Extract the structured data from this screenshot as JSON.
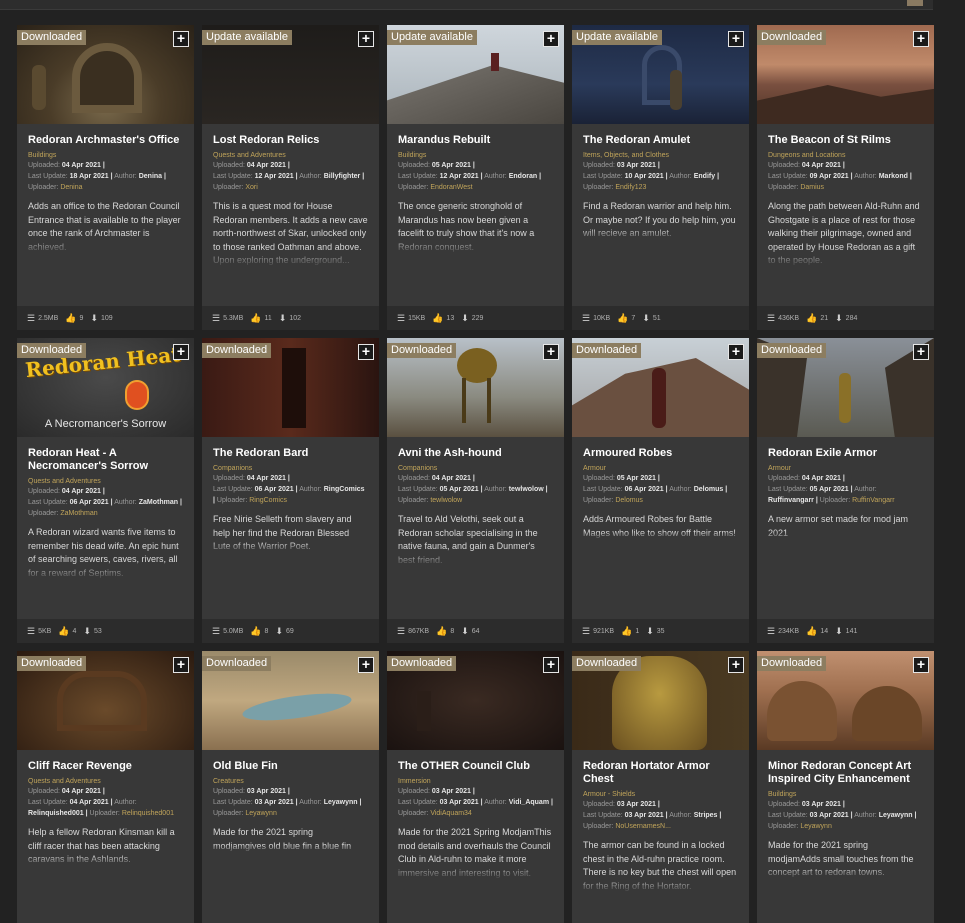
{
  "mods": [
    {
      "badge": "Downloaded",
      "title": "Redoran Archmaster's Office",
      "category": "Buildings",
      "uploaded": "04 Apr 2021",
      "last_update": "18 Apr 2021",
      "author": "Denina",
      "uploader": "Denina",
      "description": "Adds an office to the Redoran Council Entrance that is available to the player once the rank of Archmaster is achieved.",
      "size": "2.5MB",
      "endorsements": "9",
      "downloads": "109",
      "scene": "arch"
    },
    {
      "badge": "Update available",
      "title": "Lost Redoran Relics",
      "category": "Quests and Adventures",
      "uploaded": "04 Apr 2021",
      "last_update": "12 Apr 2021",
      "author": "Billyfighter",
      "uploader": "Xori",
      "description": "This is a quest mod for House Redoran members. It adds a new cave north-northwest of Skar, unlocked only to those ranked Oathman and above. Upon exploring the underground...",
      "size": "5.3MB",
      "endorsements": "11",
      "downloads": "102",
      "scene": "dark"
    },
    {
      "badge": "Update available",
      "title": "Marandus Rebuilt",
      "category": "Buildings",
      "uploaded": "05 Apr 2021",
      "last_update": "12 Apr 2021",
      "author": "Endoran",
      "uploader": "EndoranWest",
      "description": "The once generic stronghold of Marandus has now been given a facelift to truly show that it's now a Redoran conquest.",
      "size": "15KB",
      "endorsements": "13",
      "downloads": "229",
      "scene": "stairs"
    },
    {
      "badge": "Update available",
      "title": "The Redoran Amulet",
      "category": "Items, Objects, and Clothes",
      "uploaded": "03 Apr 2021",
      "last_update": "10 Apr 2021",
      "author": "Endify",
      "uploader": "Endify123",
      "description": "Find a Redoran warrior and help him. Or maybe not? If you do help him, you will recieve an amulet.",
      "size": "10KB",
      "endorsements": "7",
      "downloads": "51",
      "scene": "blue"
    },
    {
      "badge": "Downloaded",
      "title": "The Beacon of St Rilms",
      "category": "Dungeons and Locations",
      "uploaded": "04 Apr 2021",
      "last_update": "09 Apr 2021",
      "author": "Markond",
      "uploader": "Damius",
      "description": "Along the path between Ald-Ruhn and Ghostgate is a place of rest for those walking their pilgrimage, owned and operated by House Redoran as a gift to the people.",
      "size": "436KB",
      "endorsements": "21",
      "downloads": "284",
      "scene": "dusk"
    },
    {
      "badge": "Downloaded",
      "title": "Redoran Heat - A Necromancer's Sorrow",
      "category": "Quests and Adventures",
      "uploaded": "04 Apr 2021",
      "last_update": "06 Apr 2021",
      "author": "ZaMothman",
      "uploader": "ZaMothman",
      "description": "A Redoran wizard wants five items to remember his dead wife. An epic hunt of searching sewers, caves, rivers, all for a reward of Septims.",
      "size": "5KB",
      "endorsements": "4",
      "downloads": "53",
      "scene": "heat",
      "heat_title": "Redoran Heat",
      "heat_sub": "A Necromancer's Sorrow"
    },
    {
      "badge": "Downloaded",
      "title": "The Redoran Bard",
      "category": "Companions",
      "uploaded": "04 Apr 2021",
      "last_update": "06 Apr 2021",
      "author": "RingComics",
      "uploader": "RingComics",
      "description": "Free Nirie Selleth from slavery and help her find the Redoran Blessed Lute of the Warrior Poet.",
      "size": "5.0MB",
      "endorsements": "8",
      "downloads": "69",
      "scene": "room"
    },
    {
      "badge": "Downloaded",
      "title": "Avni the Ash-hound",
      "category": "Companions",
      "uploaded": "04 Apr 2021",
      "last_update": "05 Apr 2021",
      "author": "tewlwolow",
      "uploader": "tewlwolow",
      "description": "Travel to Ald Velothi, seek out a Redoran scholar specialising in the native fauna, and gain a Dunmer's best friend.",
      "size": "867KB",
      "endorsements": "8",
      "downloads": "64",
      "scene": "hound"
    },
    {
      "badge": "Downloaded",
      "title": "Armoured Robes",
      "category": "Armour",
      "uploaded": "05 Apr 2021",
      "last_update": "06 Apr 2021",
      "author": "Delomus",
      "uploader": "Delomus",
      "description": "Adds Armoured Robes for Battle Mages who like to show off their arms!",
      "size": "921KB",
      "endorsements": "1",
      "downloads": "35",
      "scene": "rock"
    },
    {
      "badge": "Downloaded",
      "title": "Redoran Exile Armor",
      "category": "Armour",
      "uploaded": "04 Apr 2021",
      "last_update": "05 Apr 2021",
      "author": "Ruffinvangarr",
      "uploader": "RuffinVangarr",
      "description": "A new armor set made for mod jam 2021",
      "size": "234KB",
      "endorsements": "14",
      "downloads": "141",
      "scene": "exile"
    },
    {
      "badge": "Downloaded",
      "title": "Cliff Racer Revenge",
      "category": "Quests and Adventures",
      "uploaded": "04 Apr 2021",
      "last_update": "04 Apr 2021",
      "author": "Relinquished001",
      "uploader": "Relinquished001",
      "description": "Help a fellow Redoran Kinsman kill a cliff racer that has been attacking caravans in the Ashlands.",
      "size": "",
      "endorsements": "",
      "downloads": "",
      "scene": "hall"
    },
    {
      "badge": "Downloaded",
      "title": "Old Blue Fin",
      "category": "Creatures",
      "uploaded": "03 Apr 2021",
      "last_update": "03 Apr 2021",
      "author": "Leyawynn",
      "uploader": "Leyawynn",
      "description": "Made for the 2021 spring modjamgives old blue fin a blue fin",
      "size": "",
      "endorsements": "",
      "downloads": "",
      "scene": "fish"
    },
    {
      "badge": "Downloaded",
      "title": "The OTHER Council Club",
      "category": "Immersion",
      "uploaded": "03 Apr 2021",
      "last_update": "03 Apr 2021",
      "author": "Vidi_Aquam",
      "uploader": "VidiAquam34",
      "description": "Made for the 2021 Spring ModjamThis mod details and overhauls the Council Club in Ald-ruhn to make it more immersive and interesting to visit.",
      "size": "",
      "endorsements": "",
      "downloads": "",
      "scene": "club"
    },
    {
      "badge": "Downloaded",
      "title": "Redoran Hortator Armor Chest",
      "category": "Armour - Shields",
      "uploaded": "03 Apr 2021",
      "last_update": "03 Apr 2021",
      "author": "Stripes",
      "uploader": "NoUsernamesN...",
      "description": "The armor can be found in a locked chest in the Ald-ruhn practice room. There is no key but the chest will open for the Ring of the Hortator.",
      "size": "",
      "endorsements": "",
      "downloads": "",
      "scene": "armor"
    },
    {
      "badge": "Downloaded",
      "title": "Minor Redoran Concept Art Inspired City Enhancement",
      "category": "Buildings",
      "uploaded": "03 Apr 2021",
      "last_update": "03 Apr 2021",
      "author": "Leyawynn",
      "uploader": "Leyawynn",
      "description": "Made for the 2021 spring modjamAdds small touches from the concept art to redoran towns.",
      "size": "",
      "endorsements": "",
      "downloads": "",
      "scene": "town"
    }
  ],
  "labels": {
    "uploaded": "Uploaded:",
    "last_update": "Last Update:",
    "author": "Author:",
    "uploader": "Uploader:",
    "add": "+"
  },
  "colors": {
    "badge": "#8c7d60",
    "accent": "#c0a45a",
    "card": "#383838",
    "footer": "#2c2c2c",
    "page": "#222222"
  }
}
